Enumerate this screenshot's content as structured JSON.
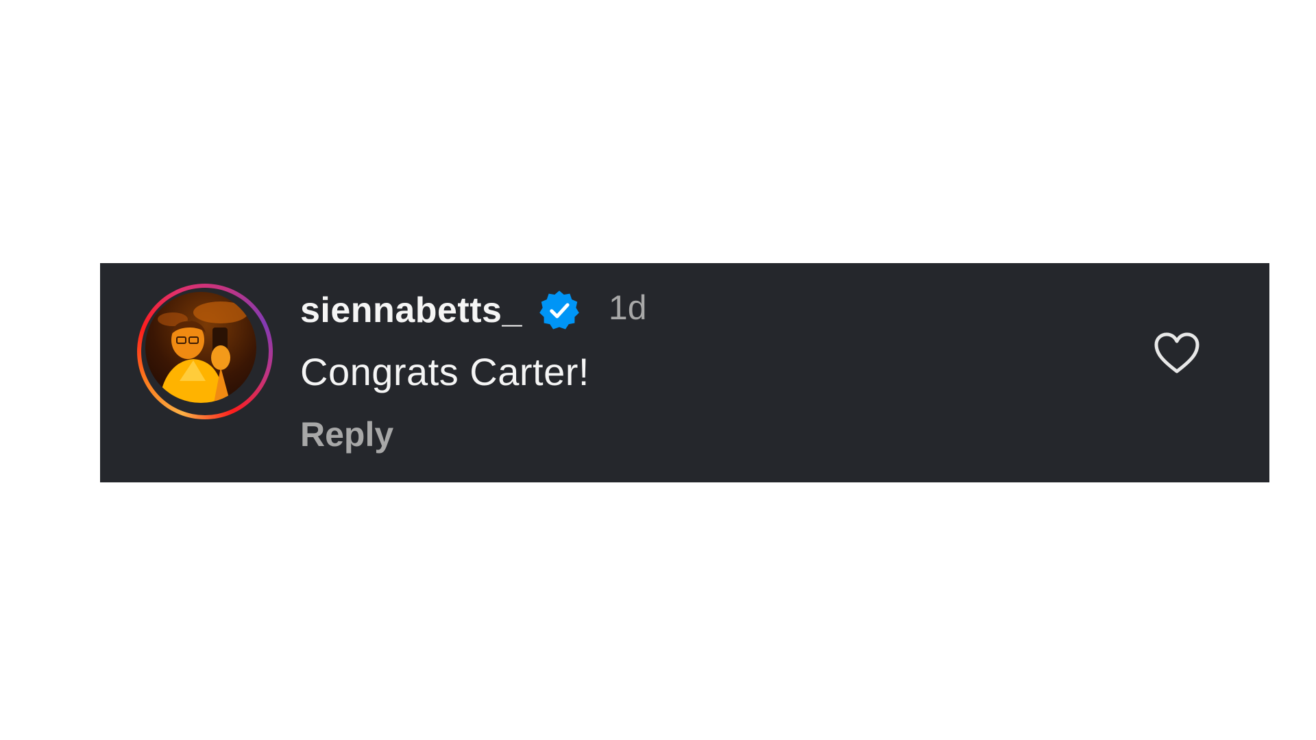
{
  "comment": {
    "username": "siennabetts_",
    "verified": true,
    "timestamp": "1d",
    "text": "Congrats Carter!",
    "reply_label": "Reply",
    "liked": false
  },
  "icons": {
    "verified": "verified-badge-icon",
    "like": "heart-outline-icon",
    "avatar": "profile-photo"
  },
  "colors": {
    "card_background": "#25272c",
    "verified_blue": "#0095f6",
    "primary_text": "#f5f5f5",
    "secondary_text": "#a8a8a8"
  }
}
